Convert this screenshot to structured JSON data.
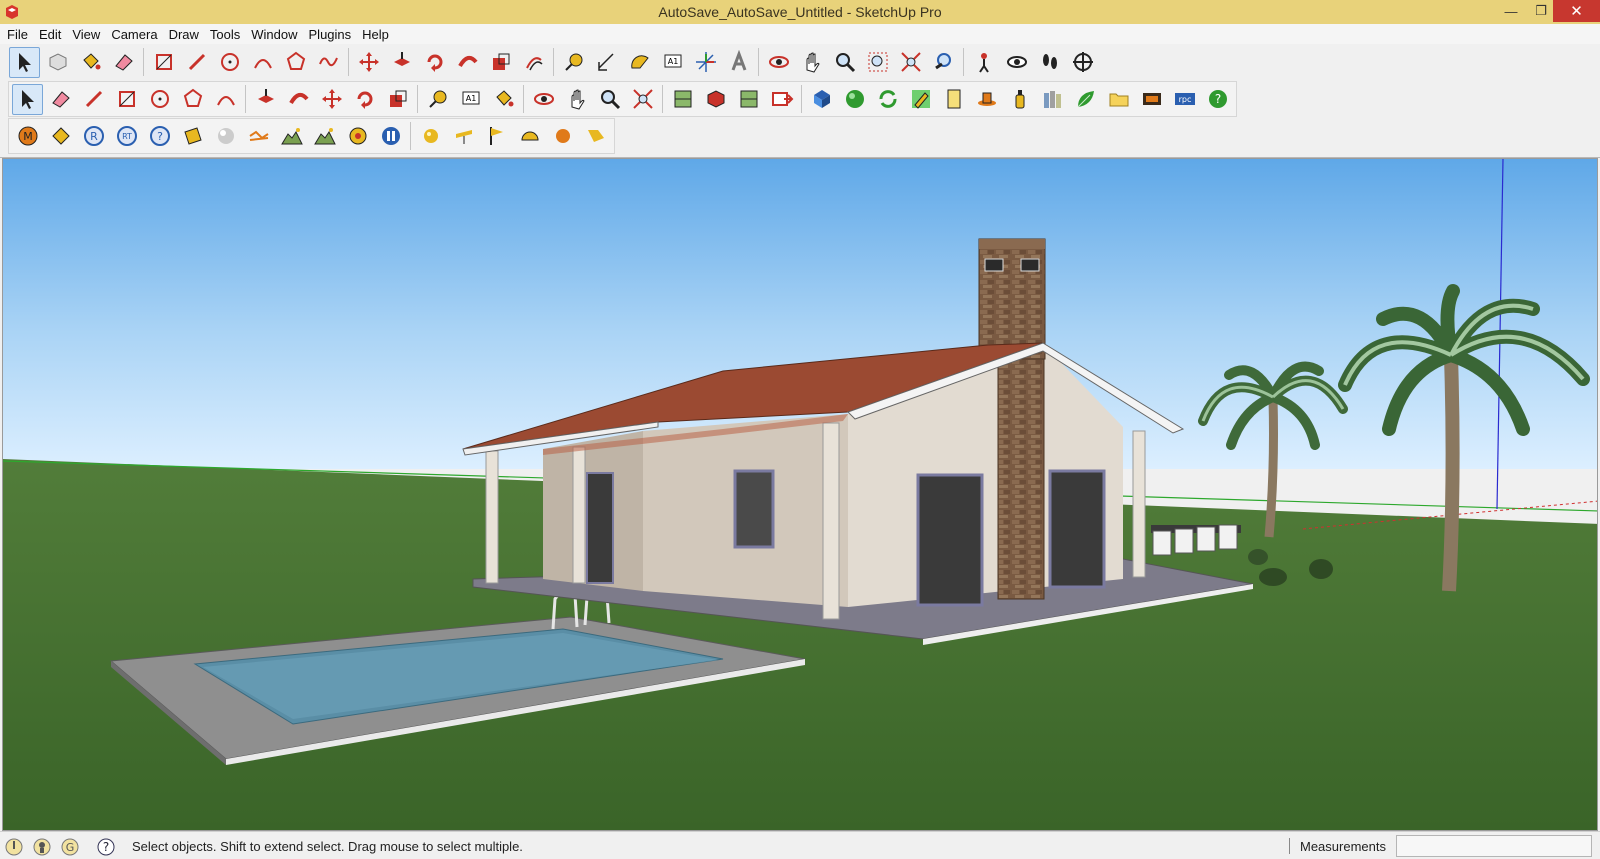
{
  "window": {
    "title": "AutoSave_AutoSave_Untitled - SketchUp Pro",
    "minimize_glyph": "—",
    "maximize_glyph": "❐",
    "close_glyph": "✕"
  },
  "menu": [
    "File",
    "Edit",
    "View",
    "Camera",
    "Draw",
    "Tools",
    "Window",
    "Plugins",
    "Help"
  ],
  "toolbar_row1": [
    "select-arrow-icon",
    "component-icon",
    "paint-bucket-icon",
    "eraser-icon",
    "sep",
    "rectangle-icon",
    "line-icon",
    "circle-icon",
    "arc-icon",
    "polygon-icon",
    "freehand-icon",
    "sep",
    "move-icon",
    "push-pull-icon",
    "rotate-icon",
    "follow-me-icon",
    "scale-icon",
    "offset-icon",
    "sep",
    "tape-measure-icon",
    "dimension-icon",
    "protractor-icon",
    "text-icon",
    "axes-icon",
    "3d-text-icon",
    "sep",
    "orbit-icon",
    "pan-icon",
    "zoom-icon",
    "zoom-window-icon",
    "zoom-extents-icon",
    "previous-view-icon",
    "sep",
    "position-camera-icon",
    "look-around-icon",
    "walk-icon",
    "section-plane-icon"
  ],
  "toolbar_row2": [
    "select-arrow-icon",
    "eraser-icon",
    "line-icon",
    "rectangle-icon",
    "circle-icon",
    "polygon-icon",
    "arc-icon",
    "sep",
    "push-pull-icon",
    "follow-me-icon",
    "move-icon",
    "rotate-icon",
    "scale-icon",
    "sep",
    "tape-measure-icon",
    "text-icon",
    "paint-bucket-icon",
    "sep",
    "orbit-icon",
    "pan-icon",
    "zoom-icon",
    "zoom-extents-icon",
    "sep",
    "warehouse-icon",
    "share-model-icon",
    "extension-warehouse-icon",
    "send-layout-icon",
    "sep",
    "sketchup-logo-icon",
    "green-sphere-icon",
    "refresh-icon",
    "pencil-icon",
    "file-icon",
    "hat-icon",
    "bottle-icon",
    "books-icon",
    "leaf-icon",
    "folder-icon",
    "film-icon",
    "rpc-icon",
    "help-icon"
  ],
  "toolbar_row3": [
    "m-badge-icon",
    "tag-icon",
    "r-badge-icon",
    "rt-badge-icon",
    "question-badge-icon",
    "label-icon",
    "sphere-icon",
    "wave-icon",
    "landscape-icon",
    "landscape-alt-icon",
    "target-icon",
    "pause-icon",
    "sep",
    "gold-sphere-icon",
    "light-icon",
    "flag-icon",
    "dome-icon",
    "orange-sphere-icon",
    "spot-light-icon"
  ],
  "status": {
    "message": "Select objects. Shift to extend select. Drag mouse to select multiple.",
    "measurements_label": "Measurements",
    "measurements_value": ""
  },
  "colors": {
    "titlebar": "#e8d27a",
    "sky_top": "#5fa8e8",
    "sky_bottom": "#d6ecfa",
    "grass": "#3f6a2b",
    "roof": "#9b4a32",
    "wall": "#d8cfc4",
    "chimney": "#7a5a42",
    "pool_water": "#5a8ea6"
  }
}
